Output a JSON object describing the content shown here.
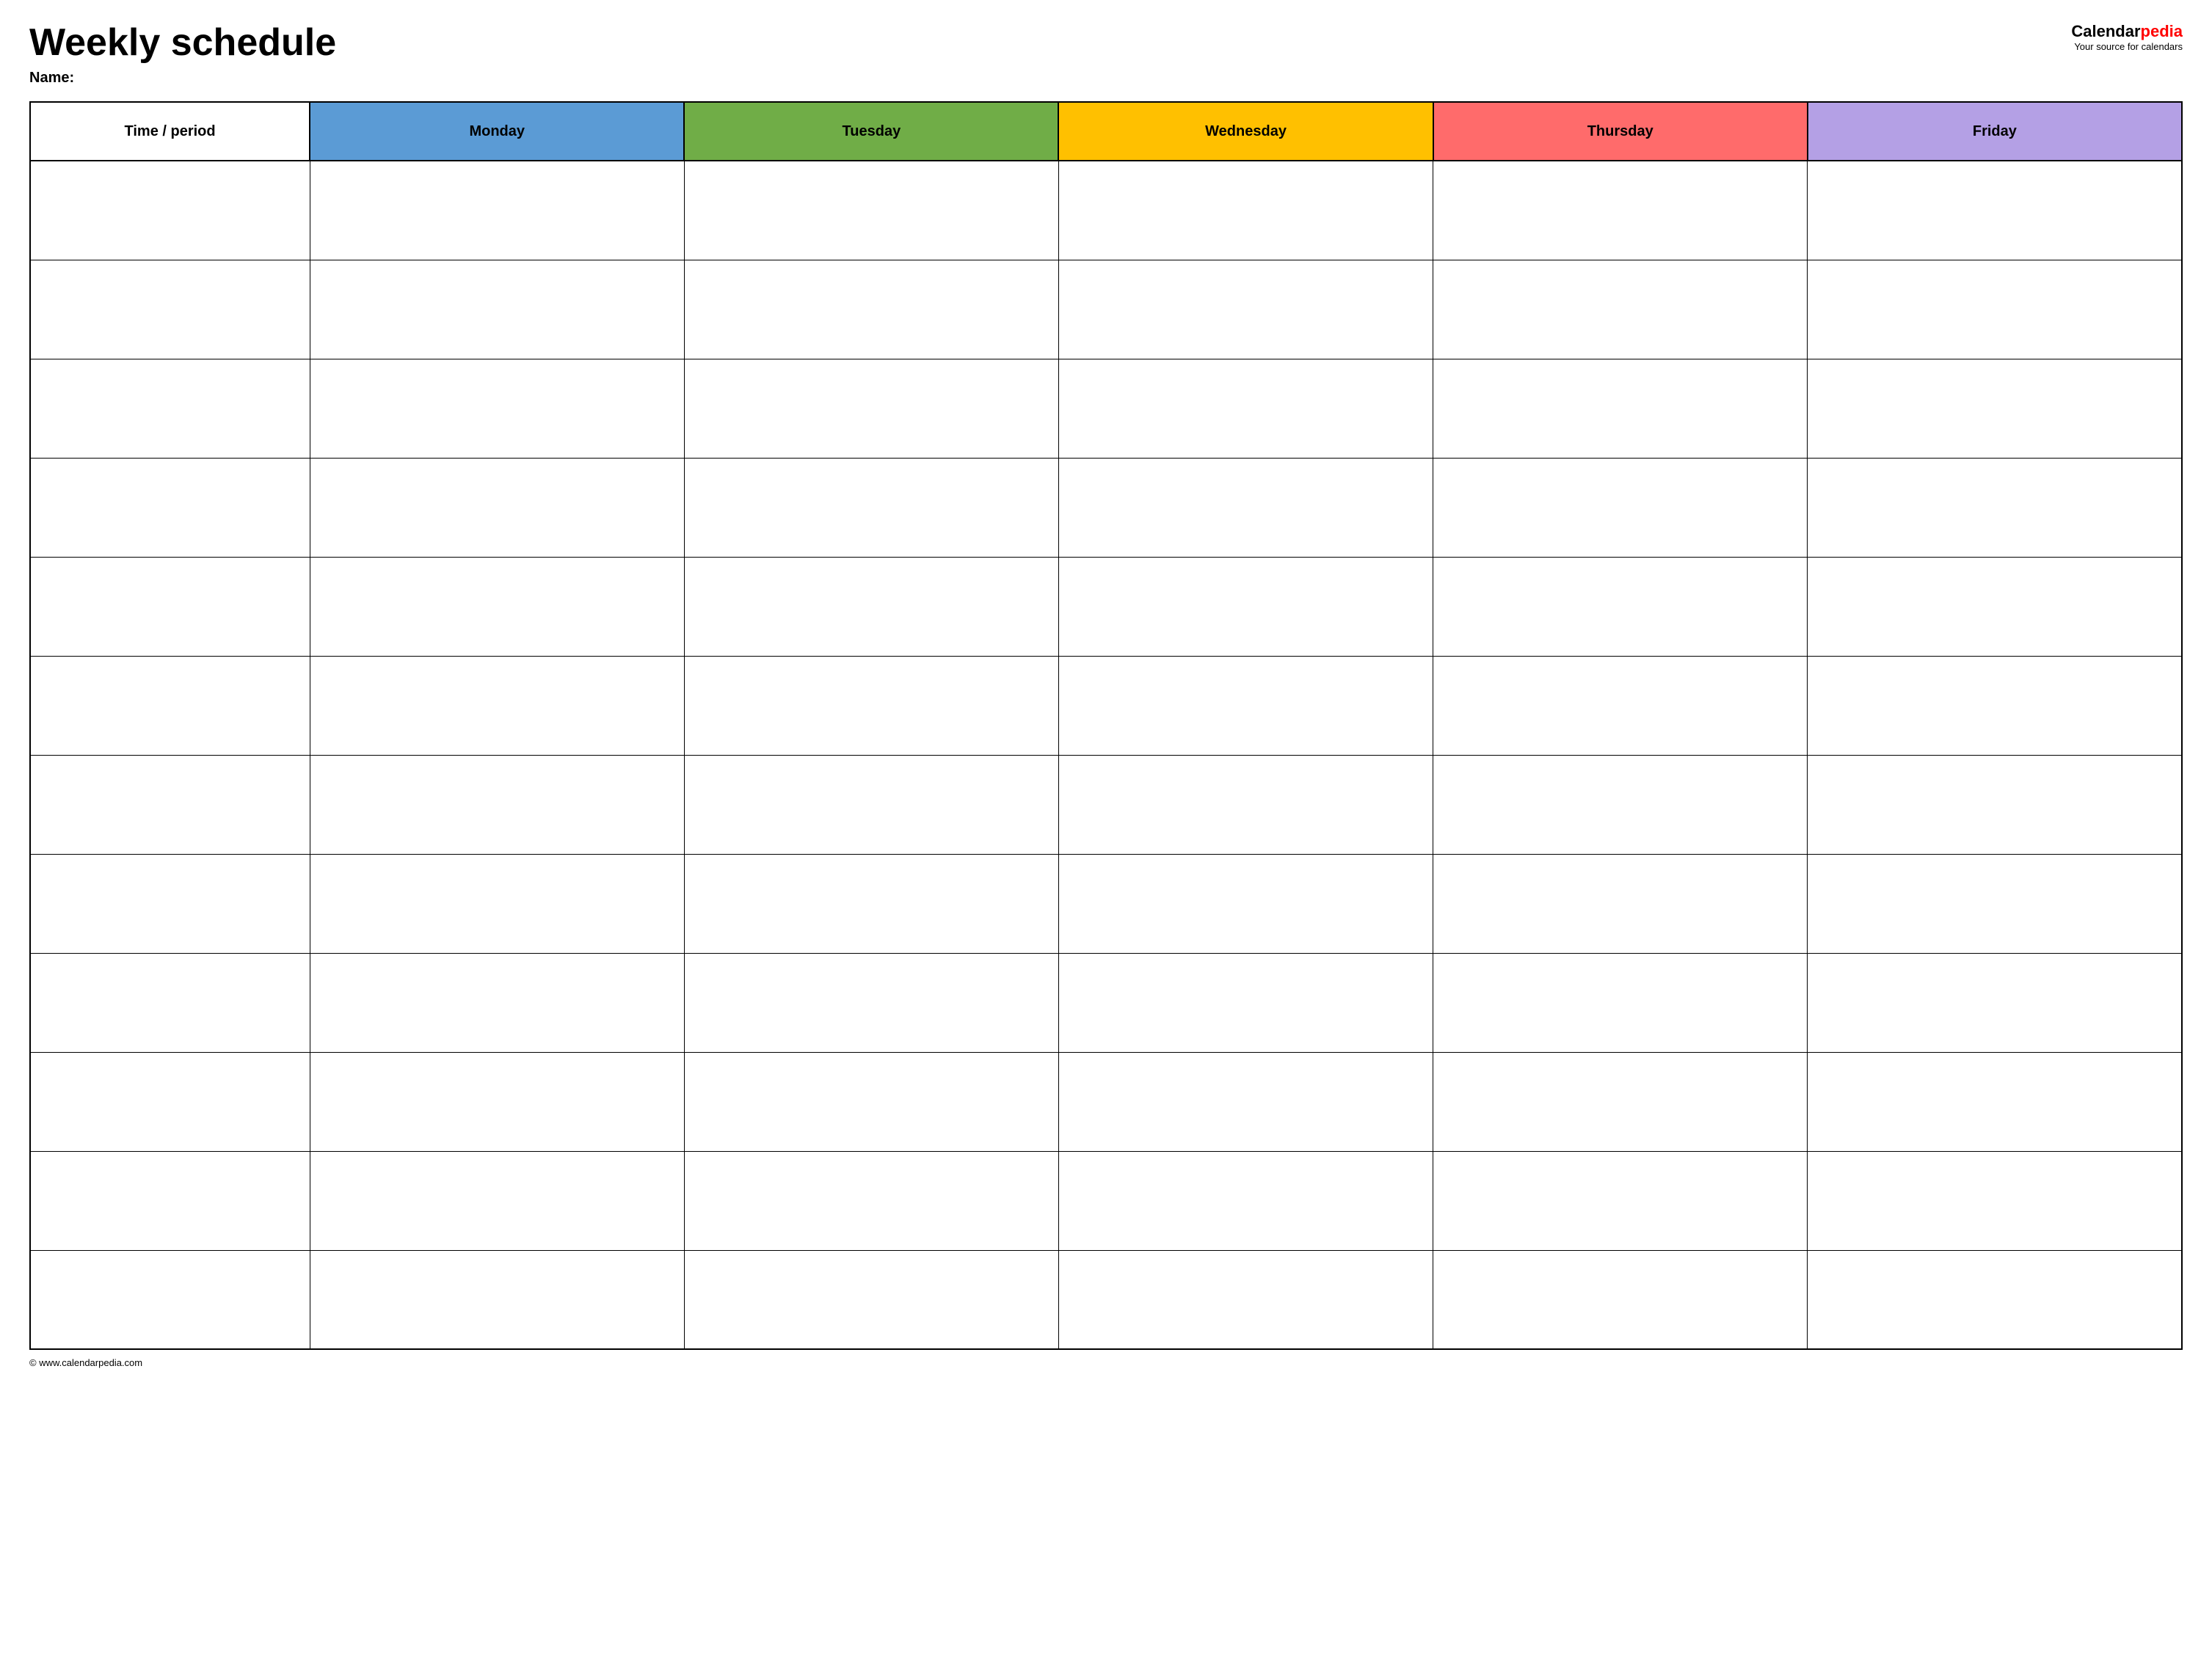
{
  "header": {
    "title": "Weekly schedule",
    "name_label": "Name:",
    "logo_text_calendar": "Calendar",
    "logo_text_pedia": "pedia",
    "logo_tagline": "Your source for calendars"
  },
  "table": {
    "columns": [
      {
        "id": "time",
        "label": "Time / period",
        "color": "#ffffff",
        "class": "th-time"
      },
      {
        "id": "monday",
        "label": "Monday",
        "color": "#5b9bd5",
        "class": "th-monday"
      },
      {
        "id": "tuesday",
        "label": "Tuesday",
        "color": "#70ad47",
        "class": "th-tuesday"
      },
      {
        "id": "wednesday",
        "label": "Wednesday",
        "color": "#ffc000",
        "class": "th-wednesday"
      },
      {
        "id": "thursday",
        "label": "Thursday",
        "color": "#ff6b6b",
        "class": "th-thursday"
      },
      {
        "id": "friday",
        "label": "Friday",
        "color": "#b4a0e5",
        "class": "th-friday"
      }
    ],
    "rows": 12
  },
  "footer": {
    "url": "© www.calendarpedia.com"
  }
}
